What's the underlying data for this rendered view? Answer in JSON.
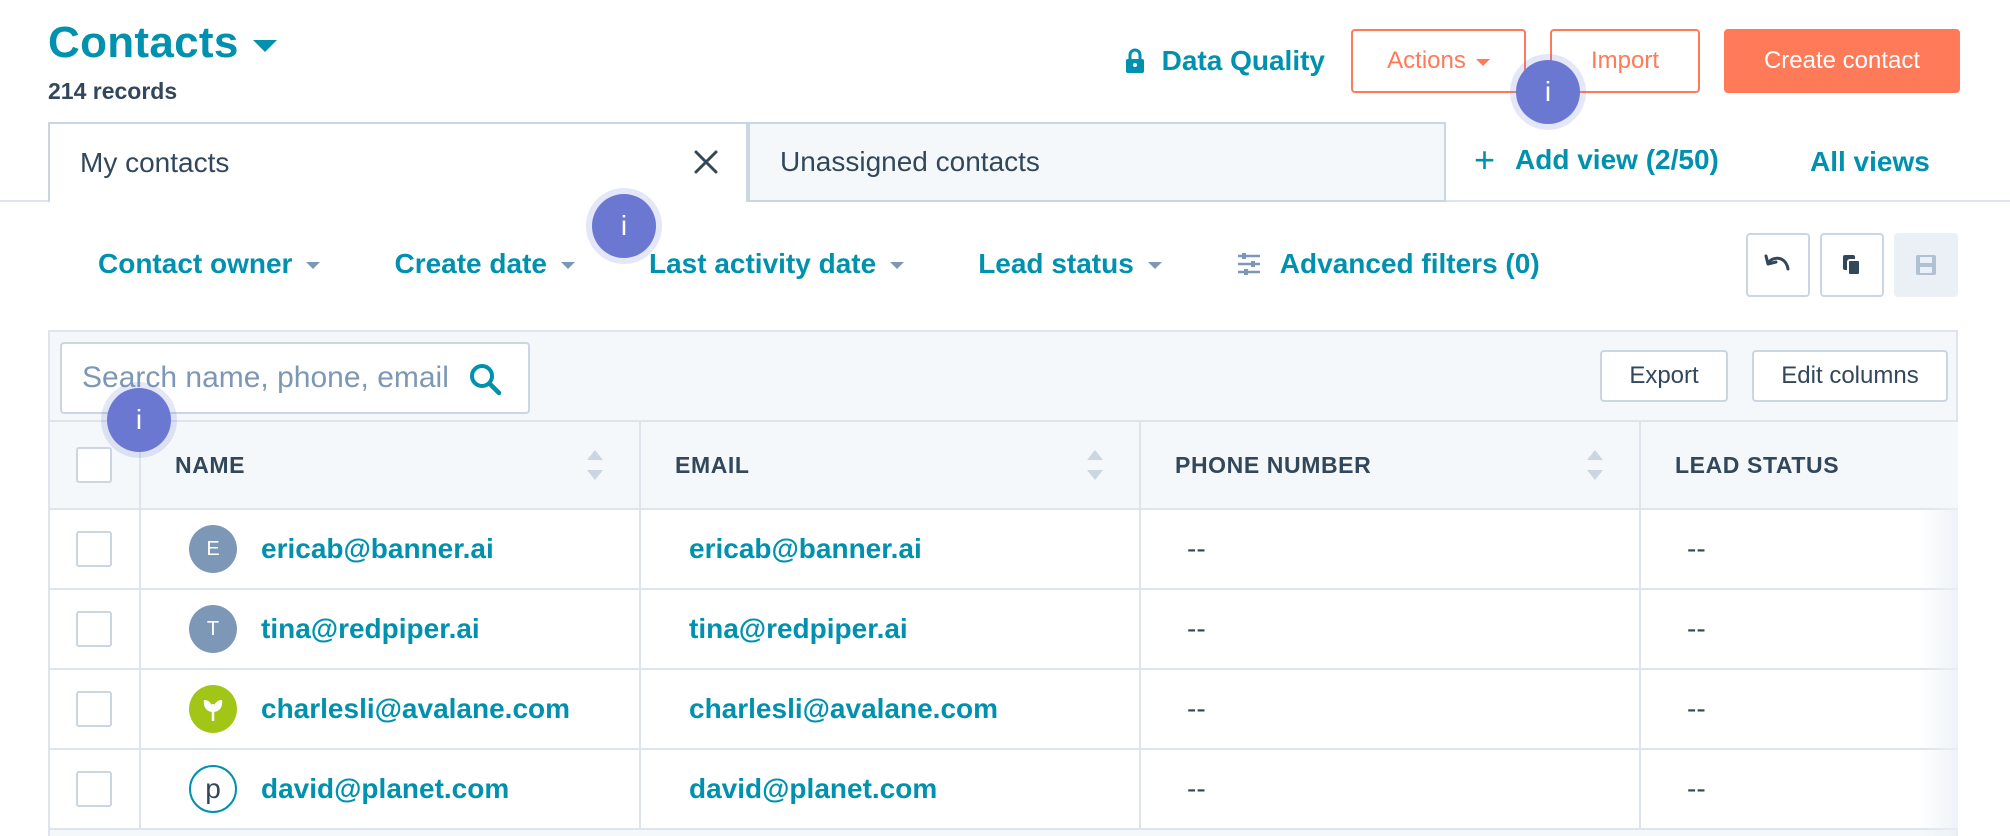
{
  "header": {
    "title": "Contacts",
    "record_count": "214 records"
  },
  "top_actions": {
    "data_quality": "Data Quality",
    "actions_label": "Actions",
    "import_label": "Import",
    "create_label": "Create contact"
  },
  "views": {
    "tabs": [
      {
        "label": "My contacts",
        "active": true
      },
      {
        "label": "Unassigned contacts",
        "active": false
      }
    ],
    "add_view": "Add view (2/50)",
    "all_views": "All views"
  },
  "filters": [
    {
      "label": "Contact owner"
    },
    {
      "label": "Create date"
    },
    {
      "label": "Last activity date"
    },
    {
      "label": "Lead status"
    }
  ],
  "advanced_filters": "Advanced filters (0)",
  "table_toolbar": {
    "search_placeholder": "Search name, phone, email",
    "export_label": "Export",
    "edit_columns_label": "Edit columns"
  },
  "table": {
    "columns": [
      "NAME",
      "EMAIL",
      "PHONE NUMBER",
      "LEAD STATUS"
    ],
    "rows": [
      {
        "avatar": "E",
        "name": "ericab@banner.ai",
        "email": "ericab@banner.ai",
        "phone": "--",
        "lead_status": "--"
      },
      {
        "avatar": "T",
        "name": "tina@redpiper.ai",
        "email": "tina@redpiper.ai",
        "phone": "--",
        "lead_status": "--"
      },
      {
        "avatar": "",
        "name": "charlesli@avalane.com",
        "email": "charlesli@avalane.com",
        "phone": "--",
        "lead_status": "--"
      },
      {
        "avatar": "p",
        "name": "david@planet.com",
        "email": "david@planet.com",
        "phone": "--",
        "lead_status": "--"
      }
    ]
  },
  "beacons": [
    "i",
    "i",
    "i"
  ],
  "colors": {
    "link_teal": "#0091ae",
    "accent_orange": "#ff7a59",
    "beacon_purple": "#6a78d1",
    "text_dark": "#33475b",
    "border": "#cbd6e2"
  }
}
